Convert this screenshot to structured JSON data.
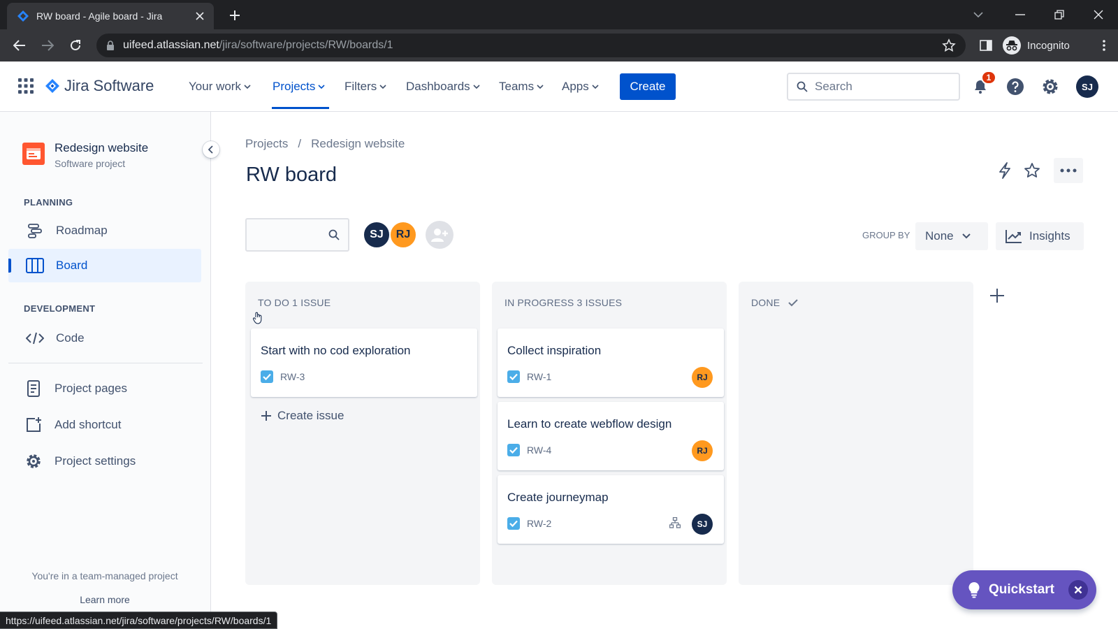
{
  "browser": {
    "tab_title": "RW board - Agile board - Jira",
    "url_host": "uifeed.atlassian.net",
    "url_path": "/jira/software/projects/RW/boards/1",
    "incognito_label": "Incognito",
    "status_url": "https://uifeed.atlassian.net/jira/software/projects/RW/boards/1"
  },
  "topnav": {
    "product": "Jira Software",
    "items": [
      "Your work",
      "Projects",
      "Filters",
      "Dashboards",
      "Teams",
      "Apps"
    ],
    "active_item": "Projects",
    "create_label": "Create",
    "search_placeholder": "Search",
    "notification_count": "1",
    "user_initials": "SJ"
  },
  "sidebar": {
    "project_name": "Redesign website",
    "project_type": "Software project",
    "planning_label": "PLANNING",
    "development_label": "DEVELOPMENT",
    "items": {
      "roadmap": "Roadmap",
      "board": "Board",
      "code": "Code",
      "project_pages": "Project pages",
      "add_shortcut": "Add shortcut",
      "project_settings": "Project settings"
    },
    "team_note": "You're in a team-managed project",
    "learn_more": "Learn more"
  },
  "main": {
    "breadcrumb": [
      "Projects",
      "Redesign website"
    ],
    "title": "RW board",
    "avatars": [
      "SJ",
      "RJ"
    ],
    "group_by_label": "GROUP BY",
    "group_by_value": "None",
    "insights_label": "Insights",
    "columns": [
      {
        "title": "TO DO 1 ISSUE",
        "cards": [
          {
            "title": "Start with no cod exploration",
            "key": "RW-3"
          }
        ],
        "create_issue": "Create issue"
      },
      {
        "title": "IN PROGRESS 3 ISSUES",
        "cards": [
          {
            "title": "Collect inspiration",
            "key": "RW-1",
            "assignee": "RJ"
          },
          {
            "title": "Learn to create webflow design",
            "key": "RW-4",
            "assignee": "RJ"
          },
          {
            "title": "Create journeymap",
            "key": "RW-2",
            "assignee": "SJ"
          }
        ]
      },
      {
        "title": "DONE",
        "cards": []
      }
    ]
  },
  "quickstart": {
    "label": "Quickstart"
  },
  "colors": {
    "brand_blue": "#0052CC",
    "browser_dark": "#202124",
    "quickstart_purple": "#6554C0",
    "avatar_rj": "#FF991F",
    "avatar_sj": "#172B4D",
    "badge_red": "#DE350B"
  }
}
